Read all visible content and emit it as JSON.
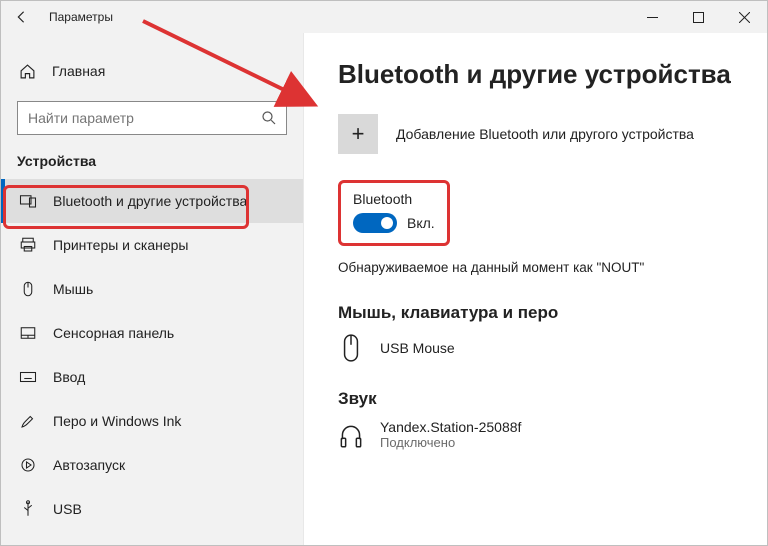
{
  "titlebar": {
    "title": "Параметры"
  },
  "sidebar": {
    "home": "Главная",
    "search_placeholder": "Найти параметр",
    "section": "Устройства",
    "items": [
      {
        "label": "Bluetooth и другие устройства"
      },
      {
        "label": "Принтеры и сканеры"
      },
      {
        "label": "Мышь"
      },
      {
        "label": "Сенсорная панель"
      },
      {
        "label": "Ввод"
      },
      {
        "label": "Перо и Windows Ink"
      },
      {
        "label": "Автозапуск"
      },
      {
        "label": "USB"
      }
    ]
  },
  "content": {
    "heading": "Bluetooth и другие устройства",
    "add_label": "Добавление Bluetooth или другого устройства",
    "bt_label": "Bluetooth",
    "bt_state": "Вкл.",
    "discoverable": "Обнаруживаемое на данный момент как \"NOUT\"",
    "subhead_input": "Мышь, клавиатура и перо",
    "subhead_audio": "Звук",
    "devices": {
      "mouse": {
        "name": "USB Mouse"
      },
      "audio": {
        "name": "Yandex.Station-25088f",
        "status": "Подключено"
      }
    }
  }
}
